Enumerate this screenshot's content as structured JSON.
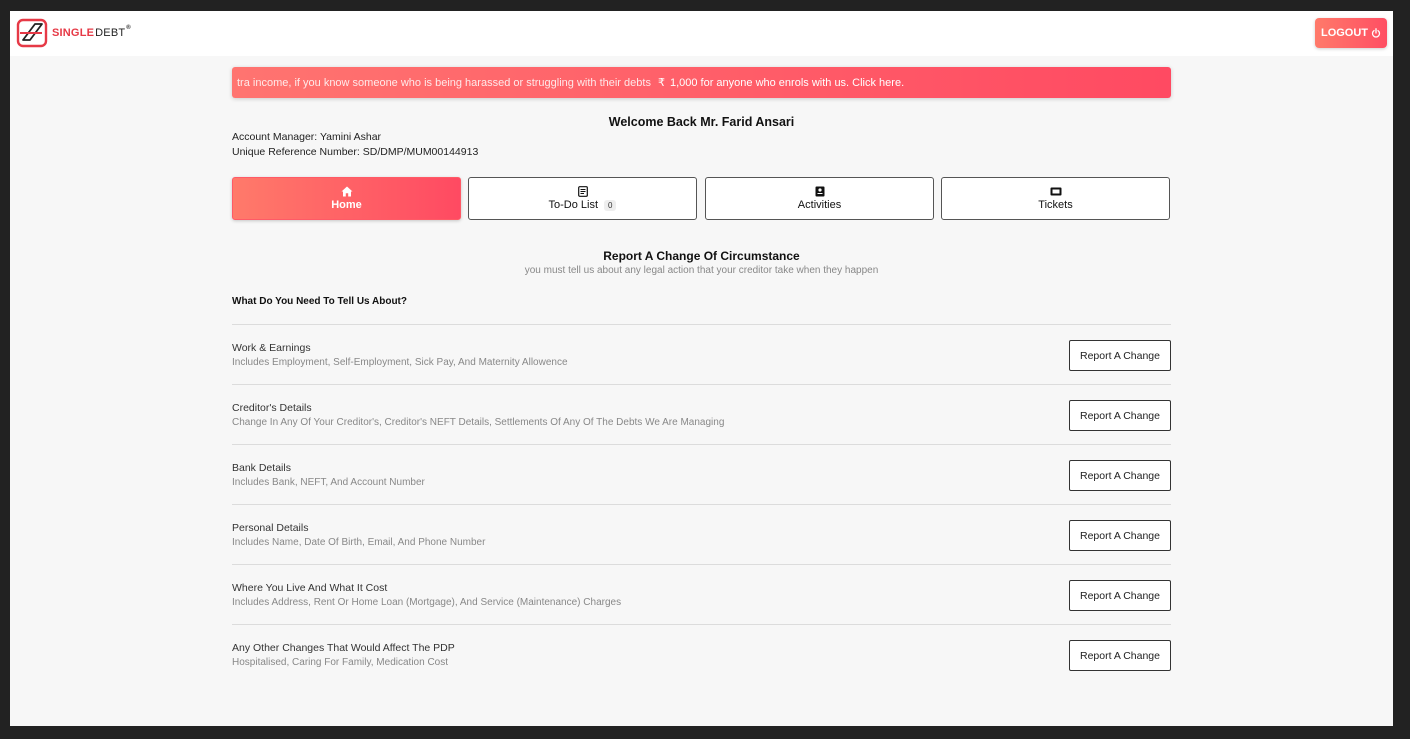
{
  "brand": {
    "name_part1": "SINGLE",
    "name_part2": "DEBT",
    "reg": "®",
    "accent": "#e63946"
  },
  "header": {
    "logout_label": "LOGOUT",
    "logout_icon": "power-icon"
  },
  "banner": {
    "text": "tra income, if you know someone who is being harassed or struggling with their debts",
    "rupee": "₹",
    "offer": "1,000 for anyone who enrols with us. Click here.",
    "color": "#ff4e63"
  },
  "welcome": "Welcome Back Mr. Farid Ansari",
  "account": {
    "manager": "Account Manager: Yamini Ashar",
    "reference": "Unique Reference Number: SD/DMP/MUM00144913"
  },
  "tabs": [
    {
      "label": "Home",
      "icon": "home-icon",
      "active": true
    },
    {
      "label": "To-Do List",
      "icon": "list-icon",
      "badge": "0"
    },
    {
      "label": "Activities",
      "icon": "book-icon"
    },
    {
      "label": "Tickets",
      "icon": "ticket-icon"
    }
  ],
  "section": {
    "title": "Report A Change Of Circumstance",
    "subtitle": "you must tell us about any legal action that your creditor take when they happen",
    "question": "What Do You Need To Tell Us About?"
  },
  "items": [
    {
      "title": "Work & Earnings",
      "desc": "Includes Employment, Self-Employment, Sick Pay, And Maternity Allowence",
      "button": "Report A Change"
    },
    {
      "title": "Creditor's Details",
      "desc": "Change In Any Of Your Creditor's, Creditor's NEFT Details, Settlements Of Any Of The Debts We Are Managing",
      "button": "Report A Change"
    },
    {
      "title": "Bank Details",
      "desc": "Includes Bank, NEFT, And Account Number",
      "button": "Report A Change"
    },
    {
      "title": "Personal Details",
      "desc": "Includes Name, Date Of Birth, Email, And Phone Number",
      "button": "Report A Change"
    },
    {
      "title": "Where You Live And What It Cost",
      "desc": "Includes Address, Rent Or Home Loan (Mortgage), And Service (Maintenance) Charges",
      "button": "Report A Change"
    },
    {
      "title": "Any Other Changes That Would Affect The PDP",
      "desc": "Hospitalised, Caring For Family, Medication Cost",
      "button": "Report A Change"
    }
  ]
}
